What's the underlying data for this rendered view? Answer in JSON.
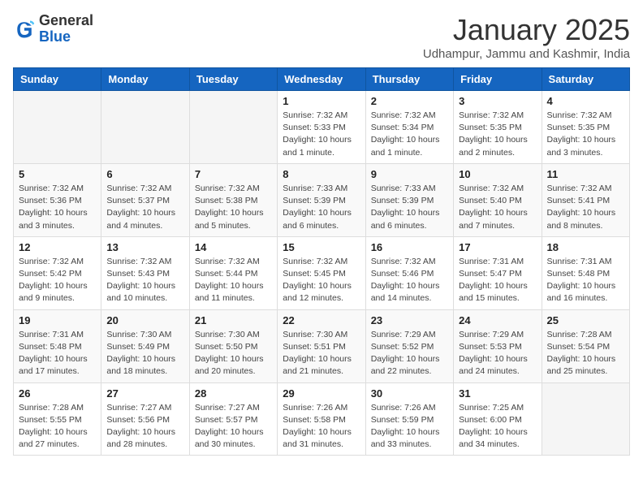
{
  "logo": {
    "general": "General",
    "blue": "Blue"
  },
  "header": {
    "month": "January 2025",
    "location": "Udhampur, Jammu and Kashmir, India"
  },
  "weekdays": [
    "Sunday",
    "Monday",
    "Tuesday",
    "Wednesday",
    "Thursday",
    "Friday",
    "Saturday"
  ],
  "weeks": [
    [
      {
        "day": "",
        "info": ""
      },
      {
        "day": "",
        "info": ""
      },
      {
        "day": "",
        "info": ""
      },
      {
        "day": "1",
        "info": "Sunrise: 7:32 AM\nSunset: 5:33 PM\nDaylight: 10 hours\nand 1 minute."
      },
      {
        "day": "2",
        "info": "Sunrise: 7:32 AM\nSunset: 5:34 PM\nDaylight: 10 hours\nand 1 minute."
      },
      {
        "day": "3",
        "info": "Sunrise: 7:32 AM\nSunset: 5:35 PM\nDaylight: 10 hours\nand 2 minutes."
      },
      {
        "day": "4",
        "info": "Sunrise: 7:32 AM\nSunset: 5:35 PM\nDaylight: 10 hours\nand 3 minutes."
      }
    ],
    [
      {
        "day": "5",
        "info": "Sunrise: 7:32 AM\nSunset: 5:36 PM\nDaylight: 10 hours\nand 3 minutes."
      },
      {
        "day": "6",
        "info": "Sunrise: 7:32 AM\nSunset: 5:37 PM\nDaylight: 10 hours\nand 4 minutes."
      },
      {
        "day": "7",
        "info": "Sunrise: 7:32 AM\nSunset: 5:38 PM\nDaylight: 10 hours\nand 5 minutes."
      },
      {
        "day": "8",
        "info": "Sunrise: 7:33 AM\nSunset: 5:39 PM\nDaylight: 10 hours\nand 6 minutes."
      },
      {
        "day": "9",
        "info": "Sunrise: 7:33 AM\nSunset: 5:39 PM\nDaylight: 10 hours\nand 6 minutes."
      },
      {
        "day": "10",
        "info": "Sunrise: 7:32 AM\nSunset: 5:40 PM\nDaylight: 10 hours\nand 7 minutes."
      },
      {
        "day": "11",
        "info": "Sunrise: 7:32 AM\nSunset: 5:41 PM\nDaylight: 10 hours\nand 8 minutes."
      }
    ],
    [
      {
        "day": "12",
        "info": "Sunrise: 7:32 AM\nSunset: 5:42 PM\nDaylight: 10 hours\nand 9 minutes."
      },
      {
        "day": "13",
        "info": "Sunrise: 7:32 AM\nSunset: 5:43 PM\nDaylight: 10 hours\nand 10 minutes."
      },
      {
        "day": "14",
        "info": "Sunrise: 7:32 AM\nSunset: 5:44 PM\nDaylight: 10 hours\nand 11 minutes."
      },
      {
        "day": "15",
        "info": "Sunrise: 7:32 AM\nSunset: 5:45 PM\nDaylight: 10 hours\nand 12 minutes."
      },
      {
        "day": "16",
        "info": "Sunrise: 7:32 AM\nSunset: 5:46 PM\nDaylight: 10 hours\nand 14 minutes."
      },
      {
        "day": "17",
        "info": "Sunrise: 7:31 AM\nSunset: 5:47 PM\nDaylight: 10 hours\nand 15 minutes."
      },
      {
        "day": "18",
        "info": "Sunrise: 7:31 AM\nSunset: 5:48 PM\nDaylight: 10 hours\nand 16 minutes."
      }
    ],
    [
      {
        "day": "19",
        "info": "Sunrise: 7:31 AM\nSunset: 5:48 PM\nDaylight: 10 hours\nand 17 minutes."
      },
      {
        "day": "20",
        "info": "Sunrise: 7:30 AM\nSunset: 5:49 PM\nDaylight: 10 hours\nand 18 minutes."
      },
      {
        "day": "21",
        "info": "Sunrise: 7:30 AM\nSunset: 5:50 PM\nDaylight: 10 hours\nand 20 minutes."
      },
      {
        "day": "22",
        "info": "Sunrise: 7:30 AM\nSunset: 5:51 PM\nDaylight: 10 hours\nand 21 minutes."
      },
      {
        "day": "23",
        "info": "Sunrise: 7:29 AM\nSunset: 5:52 PM\nDaylight: 10 hours\nand 22 minutes."
      },
      {
        "day": "24",
        "info": "Sunrise: 7:29 AM\nSunset: 5:53 PM\nDaylight: 10 hours\nand 24 minutes."
      },
      {
        "day": "25",
        "info": "Sunrise: 7:28 AM\nSunset: 5:54 PM\nDaylight: 10 hours\nand 25 minutes."
      }
    ],
    [
      {
        "day": "26",
        "info": "Sunrise: 7:28 AM\nSunset: 5:55 PM\nDaylight: 10 hours\nand 27 minutes."
      },
      {
        "day": "27",
        "info": "Sunrise: 7:27 AM\nSunset: 5:56 PM\nDaylight: 10 hours\nand 28 minutes."
      },
      {
        "day": "28",
        "info": "Sunrise: 7:27 AM\nSunset: 5:57 PM\nDaylight: 10 hours\nand 30 minutes."
      },
      {
        "day": "29",
        "info": "Sunrise: 7:26 AM\nSunset: 5:58 PM\nDaylight: 10 hours\nand 31 minutes."
      },
      {
        "day": "30",
        "info": "Sunrise: 7:26 AM\nSunset: 5:59 PM\nDaylight: 10 hours\nand 33 minutes."
      },
      {
        "day": "31",
        "info": "Sunrise: 7:25 AM\nSunset: 6:00 PM\nDaylight: 10 hours\nand 34 minutes."
      },
      {
        "day": "",
        "info": ""
      }
    ]
  ]
}
